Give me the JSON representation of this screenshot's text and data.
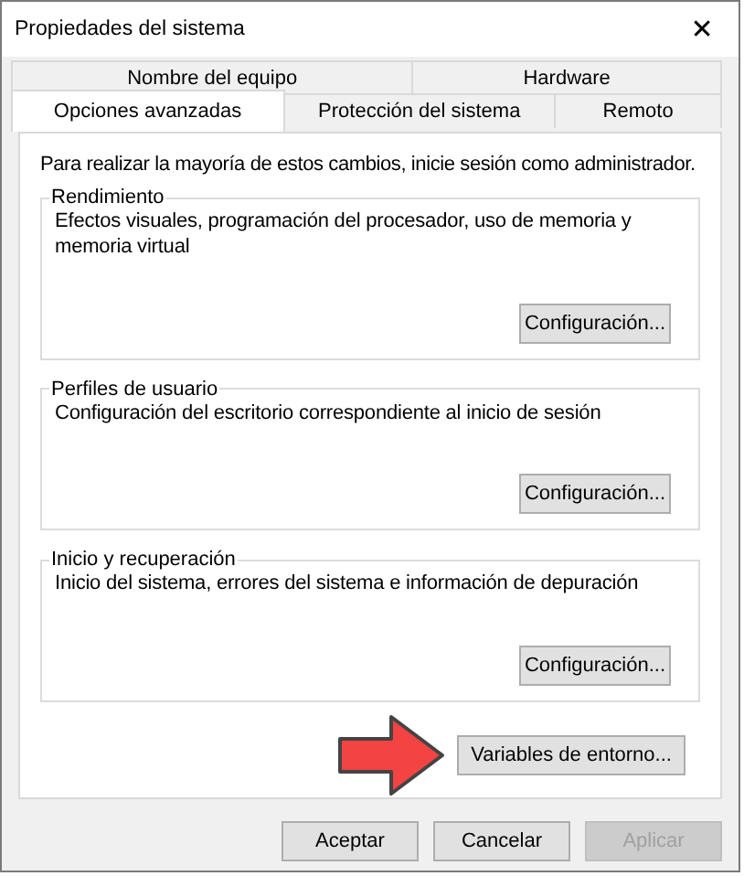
{
  "window": {
    "title": "Propiedades del sistema",
    "close": "✕"
  },
  "tab_rows": [
    [
      {
        "label": "Nombre del equipo",
        "selected": false
      },
      {
        "label": "Hardware",
        "selected": false
      }
    ],
    [
      {
        "label": "Opciones avanzadas",
        "selected": true
      },
      {
        "label": "Protección del sistema",
        "selected": false
      },
      {
        "label": "Remoto",
        "selected": false
      }
    ]
  ],
  "intro": "Para realizar la mayoría de estos cambios, inicie sesión como administrador.",
  "groups": [
    {
      "title": "Rendimiento",
      "text": "Efectos visuales, programación del procesador, uso de memoria y memoria virtual",
      "button": "Configuración..."
    },
    {
      "title": "Perfiles de usuario",
      "text": "Configuración del escritorio correspondiente al inicio de sesión",
      "button": "Configuración..."
    },
    {
      "title": "Inicio y recuperación",
      "text": "Inicio del sistema, errores del sistema e información de depuración",
      "button": "Configuración..."
    }
  ],
  "env_button": "Variables de entorno...",
  "buttons": [
    {
      "label": "Aceptar",
      "disabled": false
    },
    {
      "label": "Cancelar",
      "disabled": false
    },
    {
      "label": "Aplicar",
      "disabled": true
    }
  ]
}
